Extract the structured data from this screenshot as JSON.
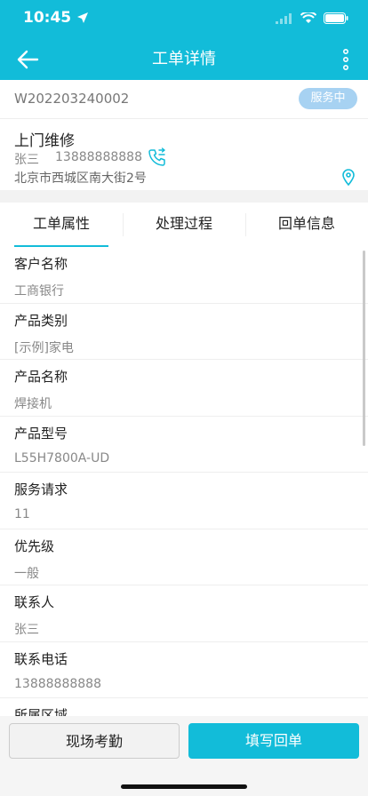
{
  "status_bar": {
    "time": "10:45"
  },
  "navbar": {
    "title": "工单详情"
  },
  "order": {
    "number": "W202203240002",
    "status": "服务中",
    "service_type": "上门维修",
    "contact_name": "张三",
    "contact_phone": "13888888888",
    "address": "北京市西城区南大街2号"
  },
  "tabs": [
    {
      "label": "工单属性",
      "active": true
    },
    {
      "label": "处理过程",
      "active": false
    },
    {
      "label": "回单信息",
      "active": false
    }
  ],
  "fields": [
    {
      "label": "客户名称",
      "value": "工商银行"
    },
    {
      "label": "产品类别",
      "value": "[示例]家电"
    },
    {
      "label": "产品名称",
      "value": "焊接机"
    },
    {
      "label": "产品型号",
      "value": "L55H7800A-UD"
    },
    {
      "label": "服务请求",
      "value": "11"
    },
    {
      "label": "优先级",
      "value": "一般"
    },
    {
      "label": "联系人",
      "value": "张三"
    },
    {
      "label": "联系电话",
      "value": "13888888888"
    },
    {
      "label": "所属区域",
      "value": ""
    }
  ],
  "actions": {
    "attendance": "现场考勤",
    "fill_receipt": "填写回单"
  },
  "colors": {
    "primary": "#12bcd9",
    "badge": "#a7d2f2"
  }
}
